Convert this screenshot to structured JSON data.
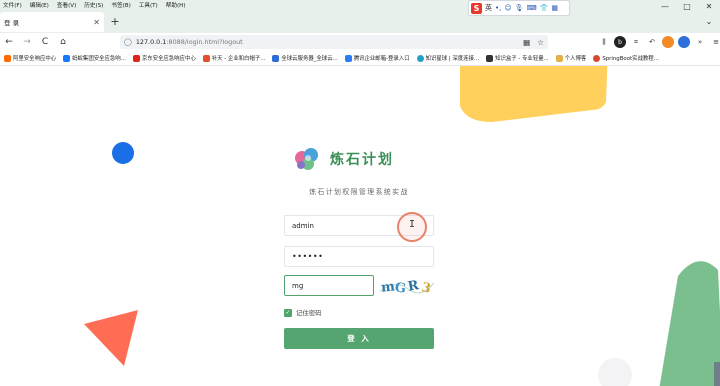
{
  "menubar": {
    "items": [
      "文件(F)",
      "编辑(E)",
      "查看(V)",
      "历史(S)",
      "书签(B)",
      "工具(T)",
      "帮助(H)"
    ]
  },
  "ime": {
    "logo": "S",
    "mode": "英"
  },
  "window_controls": {
    "minimize": "—",
    "maximize": "□",
    "close": "✕"
  },
  "tab": {
    "title": "登 录",
    "close": "✕",
    "new_tab": "+",
    "list": "⌄"
  },
  "navbar": {
    "back": "←",
    "forward": "→",
    "reload": "C",
    "home": "⌂",
    "url_host": "127.0.0.1",
    "url_rest": ":8088/login.html?logout"
  },
  "bookmarks": [
    {
      "label": "阿里安全响应中心",
      "color": "#ff6a00"
    },
    {
      "label": "蚂蚁集团安全应急响...",
      "color": "#1677ff"
    },
    {
      "label": "京东安全应急响应中心",
      "color": "#e1251b"
    },
    {
      "label": "补天 - 企业和白帽子...",
      "color": "#e34e2f"
    },
    {
      "label": "全球云服务器_全球云...",
      "color": "#2d6bd6"
    },
    {
      "label": "腾讯企业邮箱-登录入口",
      "color": "#2c7cf6"
    },
    {
      "label": "知识星球 | 深度连接...",
      "color": "#23a0c8"
    },
    {
      "label": "知识盒子 - 专业轻量...",
      "color": "#333333"
    },
    {
      "label": "个人博客",
      "color": "#e0b24a"
    },
    {
      "label": "SpringBoot实战教程...",
      "color": "#d6492f"
    }
  ],
  "login": {
    "brand_name": "炼石计划",
    "subtitle": "炼石计划权限管理系统实战",
    "username_value": "admin",
    "password_mask": "••••••",
    "captcha_value": "mg",
    "captcha_text": "mGR3",
    "remember_label": "记住密码",
    "remember_checked": "✓",
    "submit_label": "登 入",
    "accent_color": "#55a571"
  }
}
